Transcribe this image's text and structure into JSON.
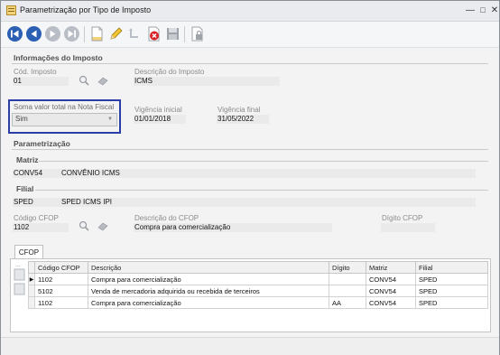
{
  "window": {
    "title": "Parametrização por Tipo de Imposto"
  },
  "sections": {
    "info": "Informações do Imposto",
    "param": "Parametrização",
    "matriz": "Matriz",
    "filial": "Filial"
  },
  "fields": {
    "cod_imposto_label": "Cód. Imposto",
    "cod_imposto": "01",
    "desc_imposto_label": "Descrição do Imposto",
    "desc_imposto": "ICMS",
    "soma_label": "Soma valor total na Nota Fiscal",
    "soma_value": "Sim",
    "vig_ini_label": "Vigência inicial",
    "vig_ini": "01/01/2018",
    "vig_fim_label": "Vigência final",
    "vig_fim": "31/05/2022",
    "matriz_cod": "CONV54",
    "matriz_desc": "CONVÊNIO ICMS",
    "filial_cod": "SPED",
    "filial_desc": "SPED ICMS IPI",
    "cfop_label": "Código CFOP",
    "cfop": "1102",
    "desc_cfop_label": "Descrição do CFOP",
    "desc_cfop": "Compra para comercialização",
    "digito_label": "Dígito CFOP"
  },
  "tab": {
    "label": "CFOP"
  },
  "grid": {
    "columns": [
      "Código CFOP",
      "Descrição",
      "Dígito",
      "Matriz",
      "Filial"
    ],
    "rows": [
      [
        "1102",
        "Compra para comercialização",
        "",
        "CONV54",
        "SPED"
      ],
      [
        "5102",
        "Venda de mercadoria adquirida ou recebida de terceiros",
        "",
        "CONV54",
        "SPED"
      ],
      [
        "1102",
        "Compra para comercialização",
        "AA",
        "CONV54",
        "SPED"
      ]
    ]
  },
  "colors": {
    "highlight_box": "#2b3ea8",
    "toolbar_nav": "#2a5fb3",
    "delete": "#d8232a"
  },
  "icons": [
    "first-record-icon",
    "previous-record-icon",
    "next-record-icon",
    "last-record-icon",
    "new-document-icon",
    "edit-pencil-icon",
    "undo-icon",
    "delete-icon",
    "save-disk-icon",
    "lock-icon",
    "search-icon",
    "eraser-icon",
    "minimize-icon",
    "maximize-icon",
    "close-icon"
  ]
}
